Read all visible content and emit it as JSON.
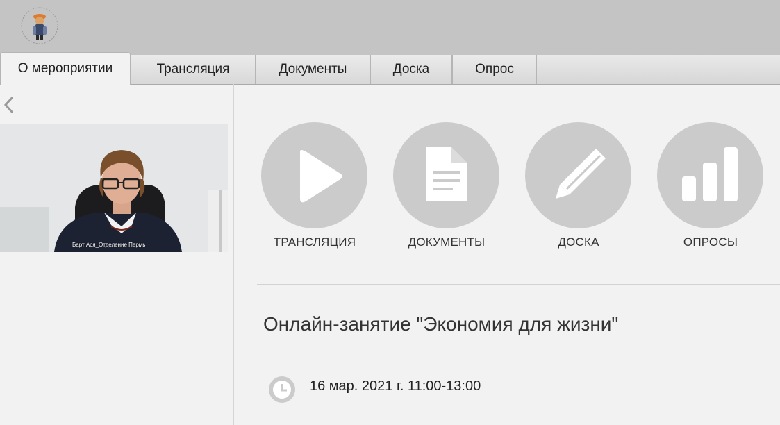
{
  "tabs": [
    {
      "label": "О мероприятии",
      "active": true
    },
    {
      "label": "Трансляция",
      "active": false
    },
    {
      "label": "Документы",
      "active": false
    },
    {
      "label": "Доска",
      "active": false
    },
    {
      "label": "Опрос",
      "active": false
    }
  ],
  "video": {
    "participant_label": "Барт Ася_Отделение Пермь"
  },
  "tiles": [
    {
      "label": "ТРАНСЛЯЦИЯ",
      "icon": "play-icon"
    },
    {
      "label": "ДОКУМЕНТЫ",
      "icon": "document-icon"
    },
    {
      "label": "ДОСКА",
      "icon": "pencil-icon"
    },
    {
      "label": "ОПРОСЫ",
      "icon": "bar-chart-icon"
    }
  ],
  "event": {
    "title": "Онлайн-занятие \"Экономия для жизни\"",
    "datetime": "16 мар. 2021 г. 11:00-13:00"
  },
  "colors": {
    "header_bg": "#c4c4c4",
    "page_bg": "#f2f2f2",
    "tile_circle": "#cbcbcb",
    "icon_fill": "#ffffff"
  }
}
